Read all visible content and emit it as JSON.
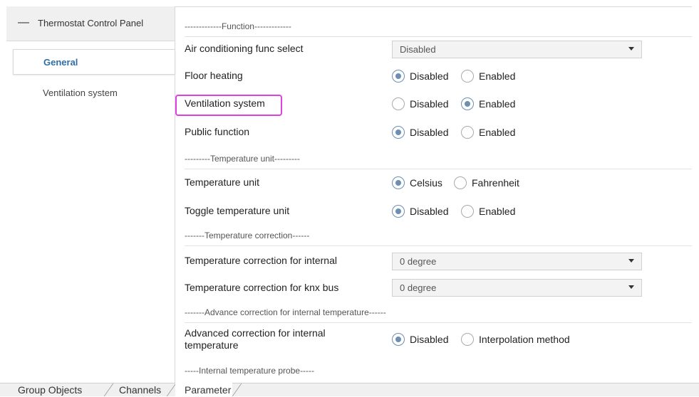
{
  "sidebar": {
    "root_label": "Thermostat Control Panel",
    "items": [
      {
        "label": "General"
      },
      {
        "label": "Ventilation system"
      }
    ]
  },
  "main": {
    "sections": {
      "function": "-------------Function-------------",
      "temperature_unit": "---------Temperature unit---------",
      "temperature_correction": "-------Temperature correction------",
      "advance_correction": "-------Advance correction for internal temperature------",
      "internal_probe": "-----Internal temperature probe-----"
    },
    "rows": {
      "air_conditioning": {
        "label": "Air conditioning func select",
        "value": "Disabled"
      },
      "floor_heating": {
        "label": "Floor heating",
        "options": [
          "Disabled",
          "Enabled"
        ],
        "selected": "Disabled"
      },
      "ventilation": {
        "label": "Ventilation system",
        "options": [
          "Disabled",
          "Enabled"
        ],
        "selected": "Enabled"
      },
      "public_function": {
        "label": "Public function",
        "options": [
          "Disabled",
          "Enabled"
        ],
        "selected": "Disabled"
      },
      "temperature_unit": {
        "label": "Temperature unit",
        "options": [
          "Celsius",
          "Fahrenheit"
        ],
        "selected": "Celsius"
      },
      "toggle_unit": {
        "label": "Toggle temperature unit",
        "options": [
          "Disabled",
          "Enabled"
        ],
        "selected": "Disabled"
      },
      "correction_internal": {
        "label": "Temperature correction for internal",
        "value": "0 degree"
      },
      "correction_knx": {
        "label": "Temperature correction for knx bus",
        "value": "0 degree"
      },
      "advanced_correction": {
        "label": "Advanced correction for internal temperature",
        "options": [
          "Disabled",
          "Interpolation method"
        ],
        "selected": "Disabled"
      }
    }
  },
  "tabs": [
    "Group Objects",
    "Channels",
    "Parameter"
  ],
  "colors": {
    "accent": "#2f6fa5",
    "highlight": "#e040e0",
    "radio_selected": "#6d8fb3"
  }
}
